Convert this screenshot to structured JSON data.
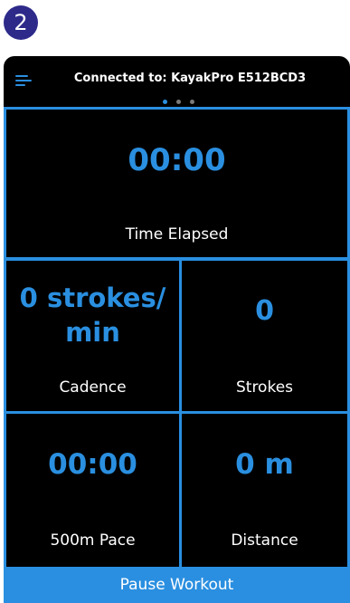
{
  "badge": "2",
  "header": {
    "connection": "Connected to: KayakPro E512BCD3"
  },
  "tiles": {
    "time": {
      "value": "00:00",
      "label": "Time Elapsed"
    },
    "cadence": {
      "value_line1": "0 strokes/",
      "value_line2": "min",
      "label": "Cadence"
    },
    "strokes": {
      "value": "0",
      "label": "Strokes"
    },
    "pace": {
      "value": "00:00",
      "label": "500m Pace"
    },
    "distance": {
      "value": "0 m",
      "label": "Distance"
    }
  },
  "footer": {
    "button": "Pause Workout"
  },
  "colors": {
    "accent": "#2a8fe0",
    "background": "#000000",
    "badge": "#2d2a8a"
  }
}
